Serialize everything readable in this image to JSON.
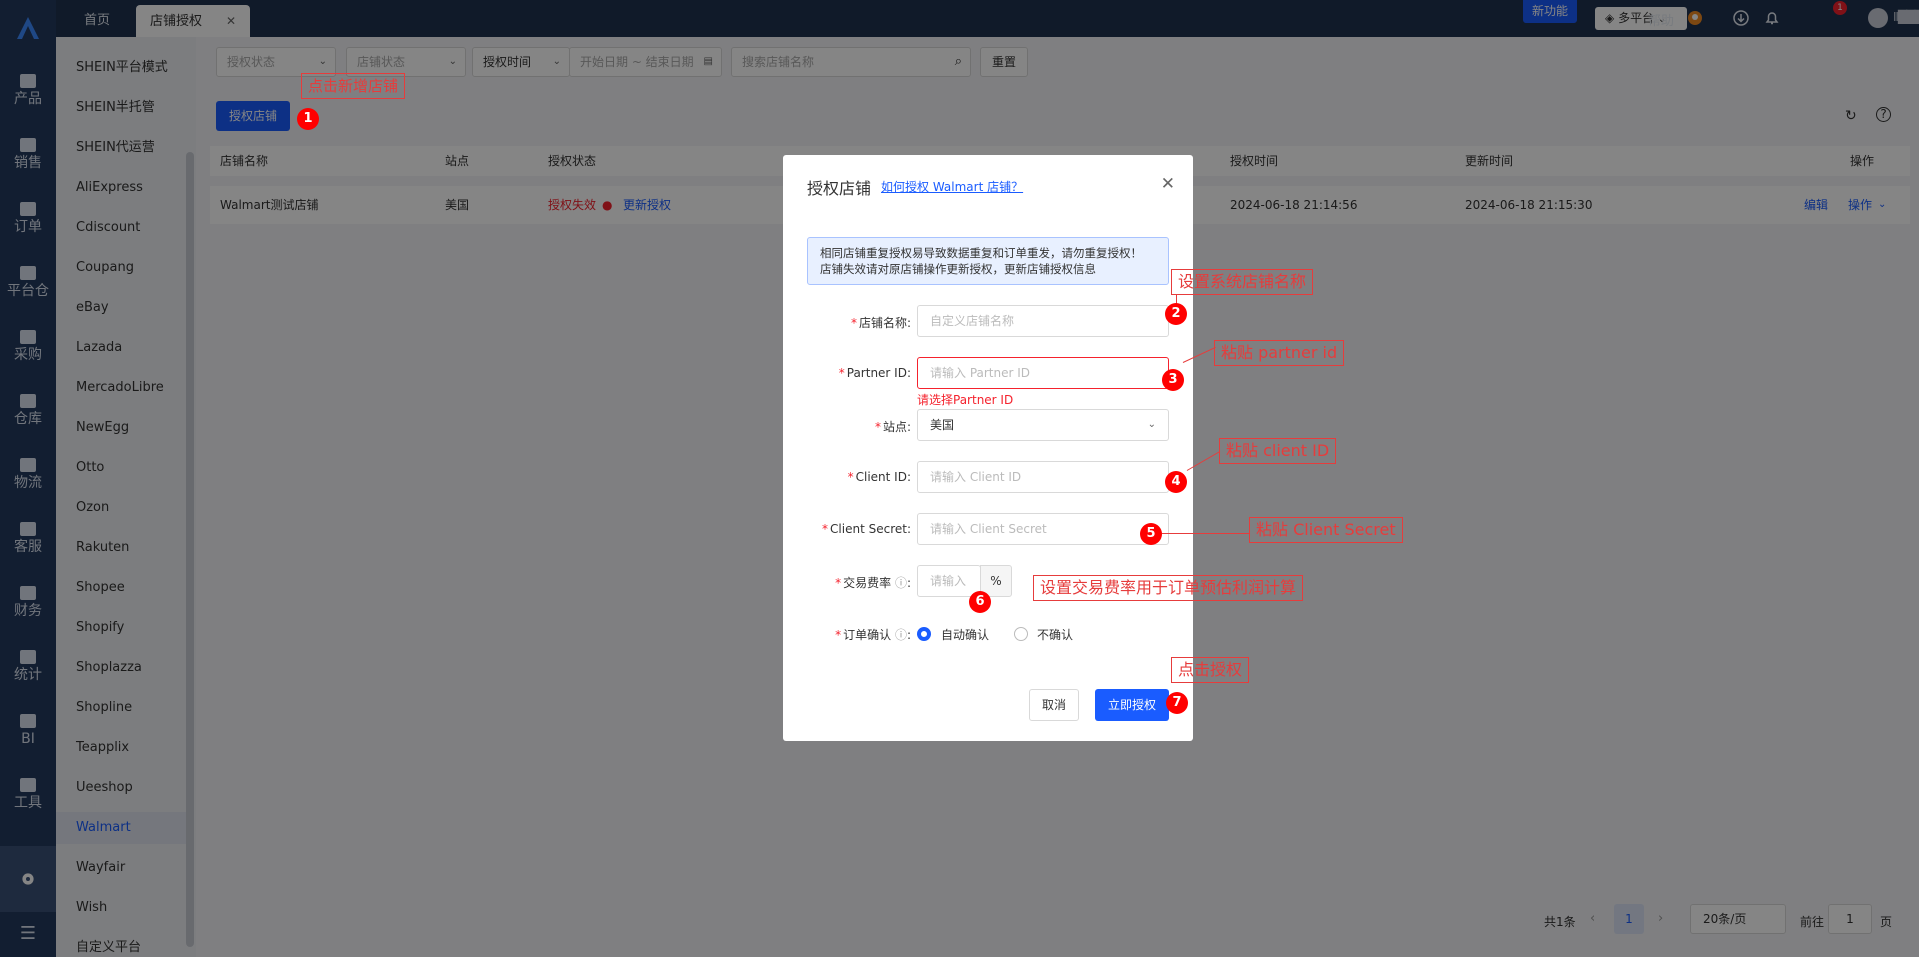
{
  "rail": {
    "items": [
      {
        "label": "产品",
        "icon": "package-icon"
      },
      {
        "label": "销售",
        "icon": "store-icon"
      },
      {
        "label": "订单",
        "icon": "order-icon"
      },
      {
        "label": "平台仓",
        "icon": "warehouse-icon"
      },
      {
        "label": "采购",
        "icon": "cart-icon"
      },
      {
        "label": "仓库",
        "icon": "depot-icon"
      },
      {
        "label": "物流",
        "icon": "truck-icon"
      },
      {
        "label": "客服",
        "icon": "mail-icon"
      },
      {
        "label": "财务",
        "icon": "coin-icon"
      },
      {
        "label": "统计",
        "icon": "pie-chart-icon"
      },
      {
        "label": "BI",
        "icon": "chart-icon"
      },
      {
        "label": "工具",
        "icon": "tool-icon"
      }
    ]
  },
  "tabs": [
    {
      "label": "首页"
    },
    {
      "label": "店铺授权"
    }
  ],
  "topbar": {
    "new_feature": "新功能",
    "platform": "多平台",
    "help": "帮助",
    "notification_count": "1",
    "user_name": "Ⅱ████"
  },
  "submenu": {
    "items": [
      "SHEIN平台模式",
      "SHEIN半托管",
      "SHEIN代运营",
      "AliExpress",
      "Cdiscount",
      "Coupang",
      "eBay",
      "Lazada",
      "MercadoLibre",
      "NewEgg",
      "Otto",
      "Ozon",
      "Rakuten",
      "Shopee",
      "Shopify",
      "Shoplazza",
      "Shopline",
      "Teapplix",
      "Ueeshop",
      "Walmart",
      "Wayfair",
      "Wish",
      "自定义平台"
    ],
    "active": "Walmart"
  },
  "filters": {
    "auth_status": "授权状态",
    "shop_status": "店铺状态",
    "auth_time": "授权时间",
    "date_range": "开始日期 ~ 结束日期",
    "search_placeholder": "搜索店铺名称",
    "reset": "重置"
  },
  "toolbar": {
    "authorize_shop": "授权店铺"
  },
  "table": {
    "headers": [
      "店铺名称",
      "站点",
      "授权状态",
      "授权时间",
      "更新时间",
      "操作"
    ],
    "rows": [
      {
        "name": "Walmart测试店铺",
        "site": "美国",
        "status": "授权失效",
        "reauth": "更新授权",
        "auth_time": "2024-06-18 21:14:56",
        "update_time": "2024-06-18 21:15:30",
        "edit": "编辑",
        "ops": "操作"
      }
    ]
  },
  "pager": {
    "total": "共1条",
    "page": "1",
    "page_size": "20条/页",
    "goto_prefix": "前往",
    "goto_value": "1",
    "goto_suffix": "页"
  },
  "modal": {
    "title": "授权店铺",
    "help_link": "如何授权 Walmart 店铺？",
    "alert_line1": "相同店铺重复授权易导致数据重复和订单重发，请勿重复授权！",
    "alert_line2": "店铺失效请对原店铺操作更新授权，更新店铺授权信息",
    "shop_name_label": "店铺名称:",
    "shop_name_placeholder": "自定义店铺名称",
    "partner_id_label": "Partner ID:",
    "partner_id_placeholder": "请输入 Partner ID",
    "partner_id_error": "请选择Partner ID",
    "site_label": "站点:",
    "site_value": "美国",
    "client_id_label": "Client ID:",
    "client_id_placeholder": "请输入 Client ID",
    "client_secret_label": "Client Secret:",
    "client_secret_placeholder": "请输入 Client Secret",
    "fee_label": "交易费率",
    "fee_placeholder": "请输入",
    "fee_unit": "%",
    "confirm_label": "订单确认",
    "confirm_auto": "自动确认",
    "confirm_none": "不确认",
    "cancel": "取消",
    "submit": "立即授权"
  },
  "annotations": {
    "n1": "点击新增店铺",
    "n2": "设置系统店铺名称",
    "n3": "粘贴 partner id",
    "n4": "粘贴 client ID",
    "n5": "粘贴 Client Secret",
    "n6": "设置交易费率用于订单预估利润计算",
    "n7": "点击授权",
    "d1": "1",
    "d2": "2",
    "d3": "3",
    "d4": "4",
    "d5": "5",
    "d6": "6",
    "d7": "7"
  },
  "colors": {
    "primary": "#1a5cff",
    "rail": "#243b5e",
    "topbar": "#1f3250",
    "danger": "#f5222d",
    "annotation": "#e63c3c"
  }
}
